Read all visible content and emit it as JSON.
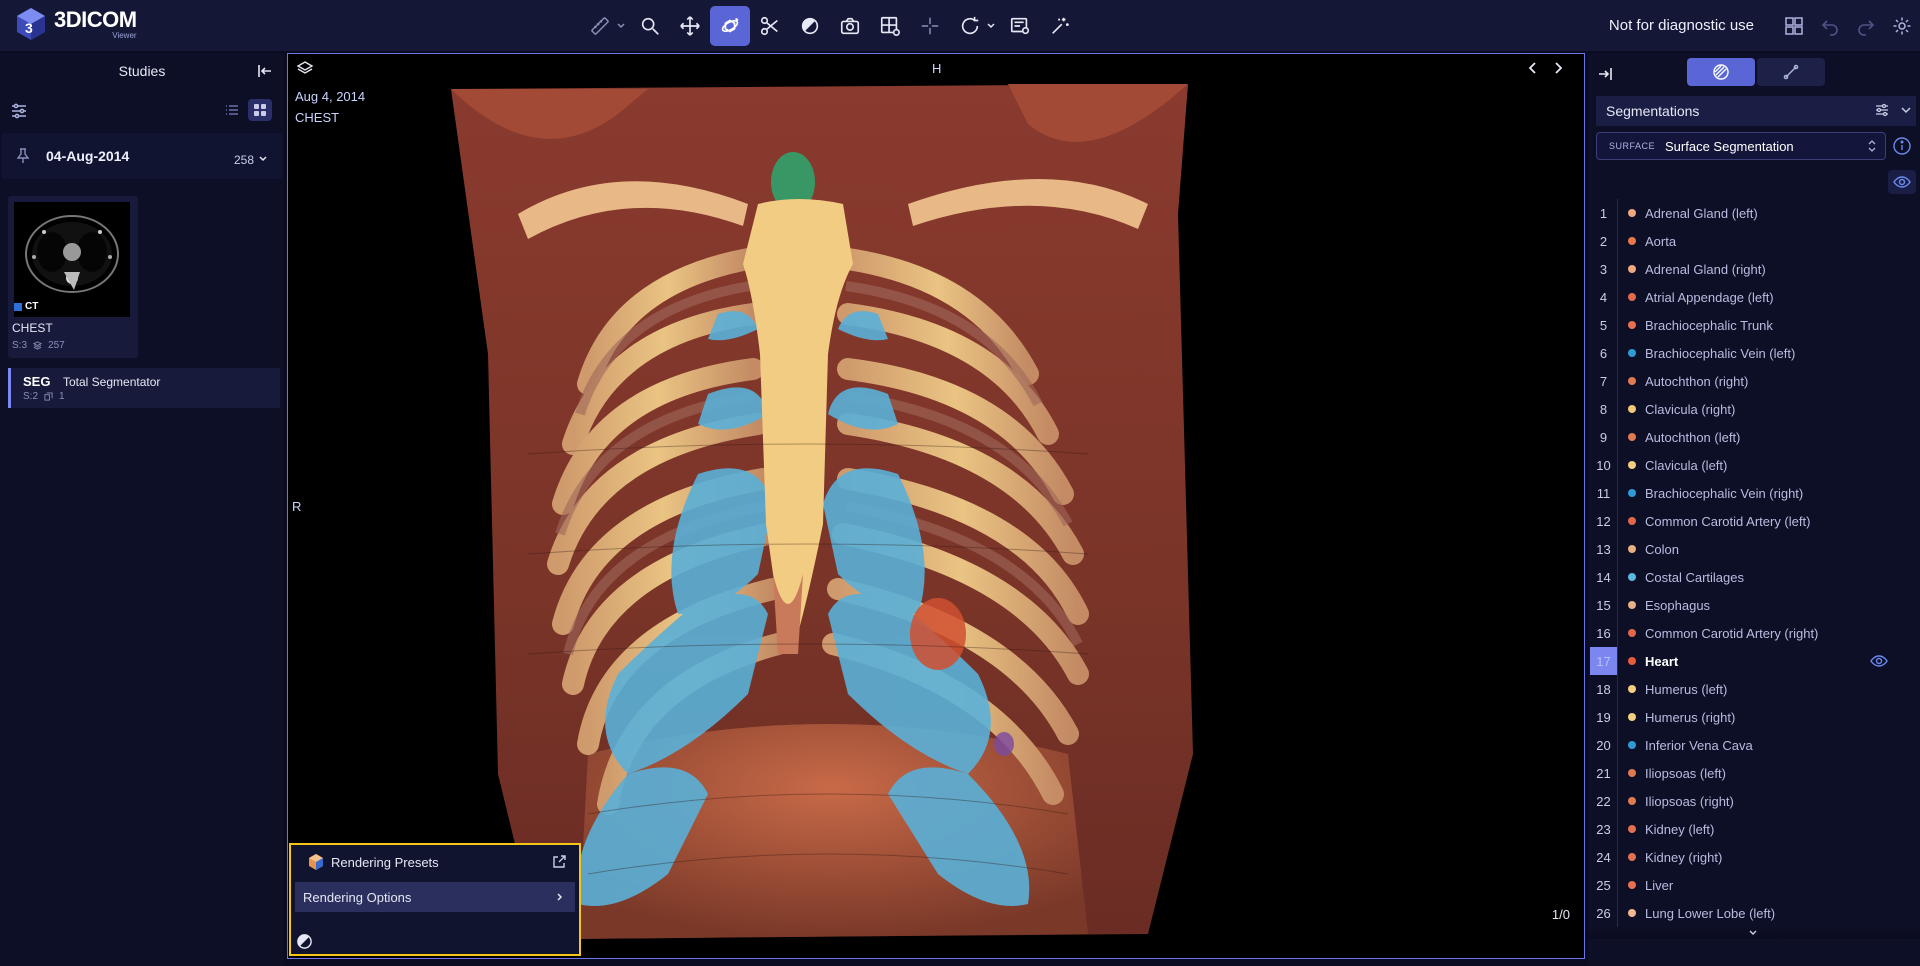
{
  "app": {
    "name": "3DICOM",
    "subtitle": "Viewer"
  },
  "topbar": {
    "disclaimer": "Not for diagnostic use",
    "tools": [
      {
        "icon": "ruler-icon"
      },
      {
        "icon": "zoom-icon"
      },
      {
        "icon": "pan-icon"
      },
      {
        "icon": "rotate-3d-icon",
        "active": true
      },
      {
        "icon": "scissors-icon"
      },
      {
        "icon": "contrast-icon"
      },
      {
        "icon": "camera-icon"
      },
      {
        "icon": "grid-settings-icon"
      },
      {
        "icon": "crosshair-icon"
      },
      {
        "icon": "reset-icon"
      },
      {
        "icon": "report-icon"
      },
      {
        "icon": "magic-icon"
      }
    ]
  },
  "left_panel": {
    "title": "Studies",
    "date_group": {
      "date": "04-Aug-2014",
      "count": "258"
    },
    "series": {
      "modality": "CT",
      "name": "CHEST",
      "series_label": "S:3",
      "image_count": "257"
    },
    "segmentation": {
      "tag": "SEG",
      "name": "Total Segmentator",
      "series_label": "S:2",
      "count": "1"
    }
  },
  "viewport": {
    "date": "Aug 4, 2014",
    "study": "CHEST",
    "orientation_top": "H",
    "orientation_left": "R",
    "counter": "1/0",
    "menu": {
      "presets_label": "Rendering Presets",
      "options_label": "Rendering Options"
    }
  },
  "right_panel": {
    "header": "Segmentations",
    "select_tag": "SURFACE",
    "select_value": "Surface Segmentation",
    "selected_index": 17,
    "segments": [
      {
        "num": "1",
        "label": "Adrenal Gland (left)",
        "color": "#f0a880"
      },
      {
        "num": "2",
        "label": "Aorta",
        "color": "#e8784a"
      },
      {
        "num": "3",
        "label": "Adrenal Gland (right)",
        "color": "#f0a880"
      },
      {
        "num": "4",
        "label": "Atrial Appendage (left)",
        "color": "#e06a4a"
      },
      {
        "num": "5",
        "label": "Brachiocephalic Trunk",
        "color": "#e87050"
      },
      {
        "num": "6",
        "label": "Brachiocephalic Vein (left)",
        "color": "#2e9ad6"
      },
      {
        "num": "7",
        "label": "Autochthon (right)",
        "color": "#e07a50"
      },
      {
        "num": "8",
        "label": "Clavicula (right)",
        "color": "#f2c878"
      },
      {
        "num": "9",
        "label": "Autochthon (left)",
        "color": "#e07a50"
      },
      {
        "num": "10",
        "label": "Clavicula (left)",
        "color": "#f2d080"
      },
      {
        "num": "11",
        "label": "Brachiocephalic Vein (right)",
        "color": "#2e9ad6"
      },
      {
        "num": "12",
        "label": "Common Carotid Artery (left)",
        "color": "#e06848"
      },
      {
        "num": "13",
        "label": "Colon",
        "color": "#e8b080"
      },
      {
        "num": "14",
        "label": "Costal Cartilages",
        "color": "#5ab8e0"
      },
      {
        "num": "15",
        "label": "Esophagus",
        "color": "#e8b088"
      },
      {
        "num": "16",
        "label": "Common Carotid Artery (right)",
        "color": "#e06848"
      },
      {
        "num": "17",
        "label": "Heart",
        "color": "#e85a3c"
      },
      {
        "num": "18",
        "label": "Humerus (left)",
        "color": "#f2d080"
      },
      {
        "num": "19",
        "label": "Humerus (right)",
        "color": "#f2d080"
      },
      {
        "num": "20",
        "label": "Inferior Vena Cava",
        "color": "#2e9ad6"
      },
      {
        "num": "21",
        "label": "Iliopsoas (left)",
        "color": "#e07a50"
      },
      {
        "num": "22",
        "label": "Iliopsoas (right)",
        "color": "#e07a50"
      },
      {
        "num": "23",
        "label": "Kidney (left)",
        "color": "#e07050"
      },
      {
        "num": "24",
        "label": "Kidney (right)",
        "color": "#e07050"
      },
      {
        "num": "25",
        "label": "Liver",
        "color": "#e87050"
      },
      {
        "num": "26",
        "label": "Lung Lower Lobe (left)",
        "color": "#f0b890"
      }
    ]
  }
}
